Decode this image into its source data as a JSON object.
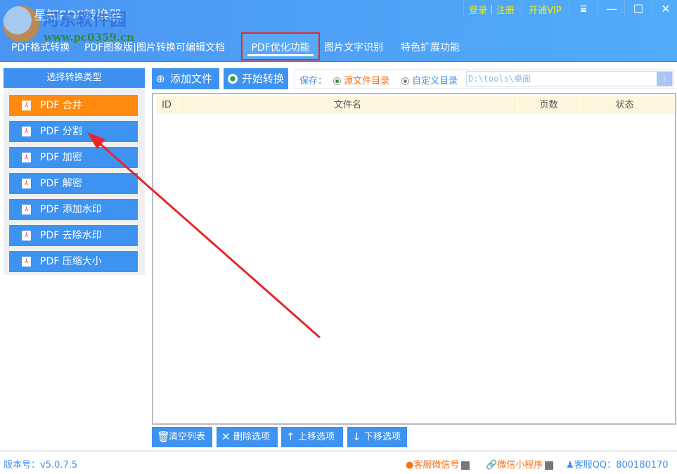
{
  "app": {
    "title": "星知PDF转换器",
    "watermark_name": "河东软件园",
    "watermark_url": "www.pc0359.cn"
  },
  "top_right": {
    "login": "登录",
    "divider": "|",
    "register": "注册",
    "vip": "开通VIP"
  },
  "window_controls": [
    "menu-icon",
    "minimize-icon",
    "maximize-icon",
    "close-icon"
  ],
  "tabs": [
    "PDF格式转换",
    "PDF图象版|图片转换可编辑文档",
    "PDF优化功能",
    "图片文字识别",
    "特色扩展功能"
  ],
  "sidebar": {
    "header": "选择转换类型",
    "items": [
      "PDF 合并",
      "PDF 分割",
      "PDF 加密",
      "PDF 解密",
      "PDF 添加水印",
      "PDF 去除水印",
      "PDF 压缩大小"
    ]
  },
  "toolbar": {
    "add": "添加文件",
    "start": "开始转换",
    "save_label": "保存：",
    "opt_source": "源文件目录",
    "opt_custom": "自定义目录",
    "path": "D:\\tools\\桌面",
    "path_btn": "⋮"
  },
  "table": {
    "columns": [
      "ID",
      "文件名",
      "页数",
      "状态"
    ],
    "rows": []
  },
  "bottom": {
    "clear": "清空列表",
    "delete": "删除选项",
    "up": "上移选项",
    "down": "下移选项"
  },
  "footer": {
    "version": "版本号：v5.0.7.5",
    "wechat": "客服微信号",
    "mini": "微信小程序",
    "qq": "客服QQ：800180170"
  },
  "colors": {
    "accent": "#3e92f0",
    "selected": "#ff8a10",
    "annotation": "#e8262a"
  }
}
